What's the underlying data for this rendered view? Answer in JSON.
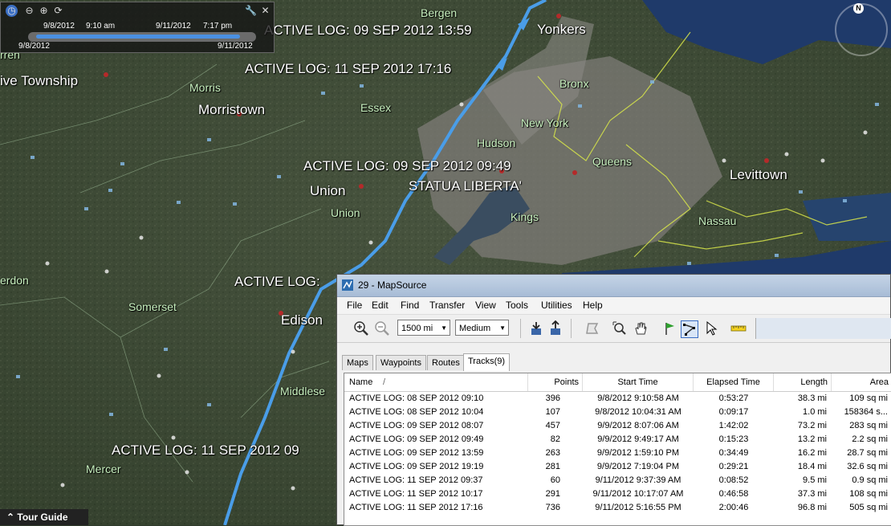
{
  "map": {
    "track_labels": [
      "ACTIVE LOG: 09 SEP 2012 13:59",
      "ACTIVE LOG: 11 SEP 2012 17:16",
      "ACTIVE LOG: 09 SEP 2012 09:49",
      "ACTIVE LOG:",
      "ACTIVE LOG: 11 SEP 2012 09"
    ],
    "places": [
      "Yonkers",
      "ive Township",
      "Morristown",
      "Union",
      "STATUA LIBERTA'",
      "Edison",
      "Levittown"
    ],
    "counties": [
      "Bergen",
      "Morris",
      "Essex",
      "Bronx",
      "New York",
      "Hudson",
      "Queens",
      "Union",
      "Kings",
      "Nassau",
      "Somerset",
      "erdon",
      "Middlese",
      "Mercer",
      "rren"
    ],
    "compass_label": "N",
    "colors": {
      "track": "#4a9de8",
      "county_border": "#d8e64a",
      "water": "#1f3a6a"
    }
  },
  "time_slider": {
    "current_start": "9/8/2012",
    "current_start_time": "9:10 am",
    "current_end": "9/11/2012",
    "current_end_time": "7:17 pm",
    "range_start": "9/8/2012",
    "range_end": "9/11/2012"
  },
  "tour_guide": {
    "label": "Tour Guide"
  },
  "mapsource": {
    "title": "29 - MapSource",
    "menu": [
      "File",
      "Edit",
      "Find",
      "Transfer",
      "View",
      "Tools",
      "Utilities",
      "Help"
    ],
    "toolbar": {
      "scale": "1500 mi",
      "detail": "Medium"
    },
    "tabs": [
      "Maps",
      "Waypoints",
      "Routes",
      "Tracks(9)"
    ],
    "columns": [
      "Name",
      "Points",
      "Start Time",
      "Elapsed Time",
      "Length",
      "Area"
    ],
    "sort_indicator": "/",
    "rows": [
      [
        "ACTIVE LOG: 08 SEP 2012 09:10",
        "396",
        "9/8/2012 9:10:58 AM",
        "0:53:27",
        "38.3 mi",
        "109 sq mi"
      ],
      [
        "ACTIVE LOG: 08 SEP 2012 10:04",
        "107",
        "9/8/2012 10:04:31 AM",
        "0:09:17",
        "1.0 mi",
        "158364 s..."
      ],
      [
        "ACTIVE LOG: 09 SEP 2012 08:07",
        "457",
        "9/9/2012 8:07:06 AM",
        "1:42:02",
        "73.2 mi",
        "283 sq mi"
      ],
      [
        "ACTIVE LOG: 09 SEP 2012 09:49",
        "82",
        "9/9/2012 9:49:17 AM",
        "0:15:23",
        "13.2 mi",
        "2.2 sq mi"
      ],
      [
        "ACTIVE LOG: 09 SEP 2012 13:59",
        "263",
        "9/9/2012 1:59:10 PM",
        "0:34:49",
        "16.2 mi",
        "28.7 sq mi"
      ],
      [
        "ACTIVE LOG: 09 SEP 2012 19:19",
        "281",
        "9/9/2012 7:19:04 PM",
        "0:29:21",
        "18.4 mi",
        "32.6 sq mi"
      ],
      [
        "ACTIVE LOG: 11 SEP 2012 09:37",
        "60",
        "9/11/2012 9:37:39 AM",
        "0:08:52",
        "9.5 mi",
        "0.9 sq mi"
      ],
      [
        "ACTIVE LOG: 11 SEP 2012 10:17",
        "291",
        "9/11/2012 10:17:07 AM",
        "0:46:58",
        "37.3 mi",
        "108 sq mi"
      ],
      [
        "ACTIVE LOG: 11 SEP 2012 17:16",
        "736",
        "9/11/2012 5:16:55 PM",
        "2:00:46",
        "96.8 mi",
        "505 sq mi"
      ]
    ]
  }
}
